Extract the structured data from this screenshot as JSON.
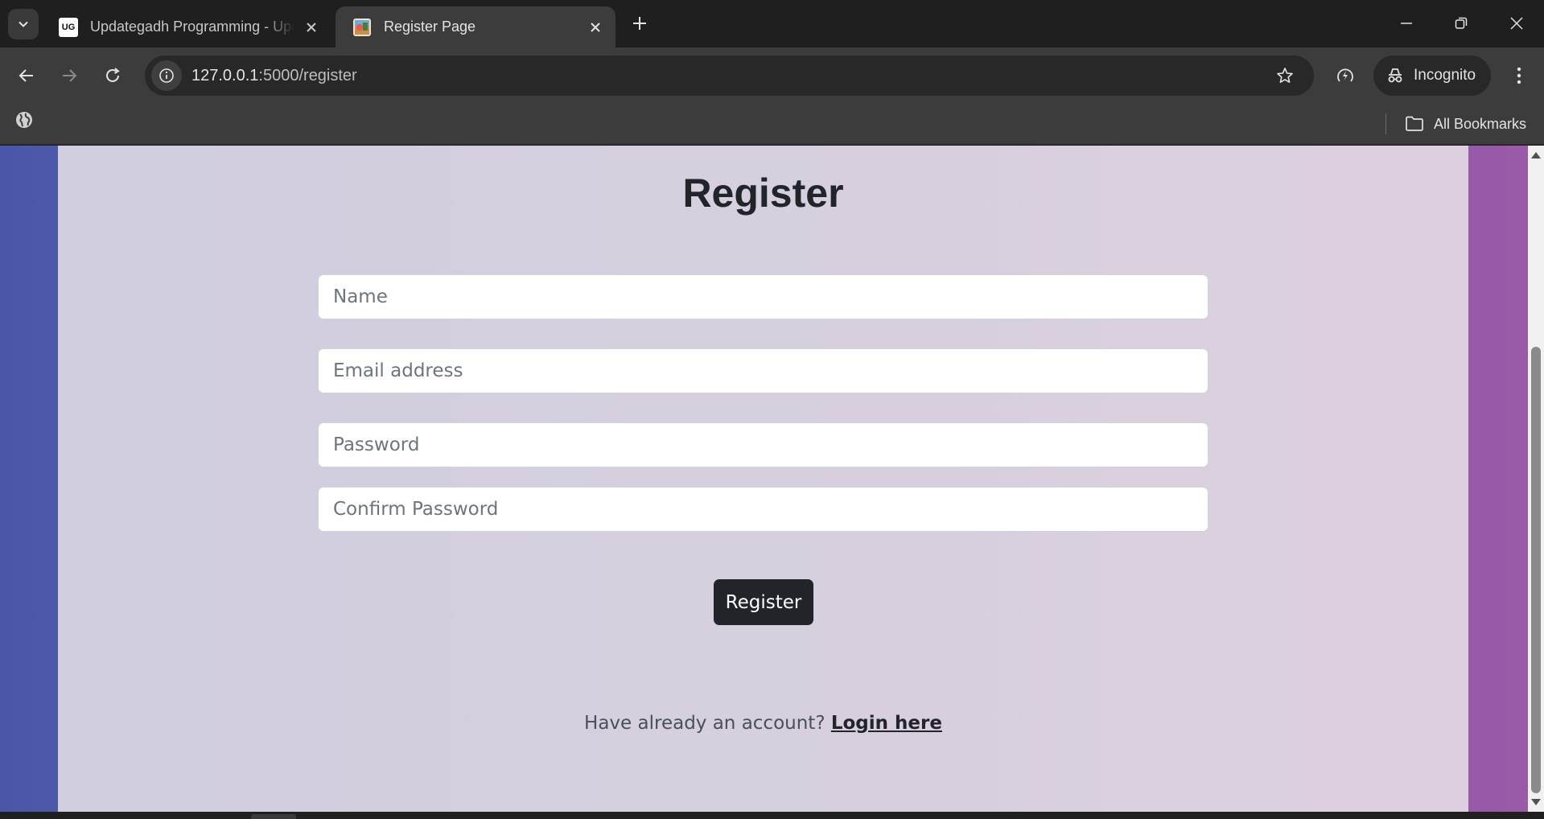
{
  "browser": {
    "tabs": [
      {
        "title": "Updategadh Programming - Updategadh",
        "favicon": "UG",
        "active": false
      },
      {
        "title": "Register Page",
        "active": true
      }
    ],
    "url_host": "127.0.0.1",
    "url_rest": ":5000/register",
    "profile_label": "Incognito",
    "bookmarks_all_label": "All Bookmarks"
  },
  "page": {
    "heading": "Register",
    "fields": {
      "name_placeholder": "Name",
      "email_placeholder": "Email address",
      "password_placeholder": "Password",
      "confirm_placeholder": "Confirm Password"
    },
    "submit_label": "Register",
    "login_prompt": "Have already an account?",
    "login_link": "Login here"
  },
  "colors": {
    "card_background": "#d6cfde",
    "button_background": "#212529",
    "bg_gradient_left": "#4a57a8",
    "bg_gradient_right": "#9a5aa8"
  }
}
